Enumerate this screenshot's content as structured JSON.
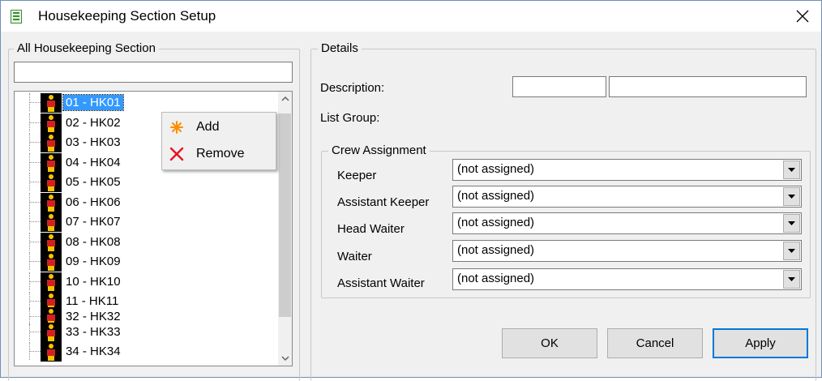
{
  "window": {
    "title": "Housekeeping Section Setup"
  },
  "left_panel": {
    "legend": "All Housekeeping Section",
    "filter_value": ""
  },
  "tree": {
    "items": [
      {
        "label": "01 - HK01",
        "selected": true
      },
      {
        "label": "02 - HK02"
      },
      {
        "label": "03 - HK03"
      },
      {
        "label": "04 - HK04"
      },
      {
        "label": "05 - HK05"
      },
      {
        "label": "06 - HK06"
      },
      {
        "label": "07 - HK07"
      },
      {
        "label": "08 - HK08"
      },
      {
        "label": "09 - HK09"
      },
      {
        "label": "10 - HK10"
      },
      {
        "label": "11 - HK11"
      },
      {
        "label": "32 - HK32"
      },
      {
        "label": "33 - HK33"
      },
      {
        "label": "34 - HK34"
      }
    ]
  },
  "context_menu": {
    "add_label": "Add",
    "remove_label": "Remove"
  },
  "details": {
    "legend": "Details",
    "description_label": "Description:",
    "description_code": "",
    "description_text": "",
    "list_group_label": "List Group:"
  },
  "crew": {
    "legend": "Crew Assignment",
    "rows": [
      {
        "label": "Keeper",
        "value": "(not assigned)"
      },
      {
        "label": "Assistant Keeper",
        "value": "(not assigned)"
      },
      {
        "label": "Head Waiter",
        "value": "(not assigned)"
      },
      {
        "label": "Waiter",
        "value": "(not assigned)"
      },
      {
        "label": "Assistant Waiter",
        "value": "(not assigned)"
      }
    ]
  },
  "buttons": {
    "ok": "OK",
    "cancel": "Cancel",
    "apply": "Apply"
  },
  "colors": {
    "selection": "#3399ff",
    "accent_border": "#0078d7",
    "add_icon": "#ff8c00",
    "remove_icon": "#e81123",
    "tree_icon_body": "#d62020",
    "tree_icon_head": "#f5c400"
  },
  "icons": {
    "app": "document-icon",
    "close": "close-icon",
    "add": "asterisk-icon",
    "remove": "x-mark-icon",
    "tree_item": "housekeeper-icon"
  }
}
